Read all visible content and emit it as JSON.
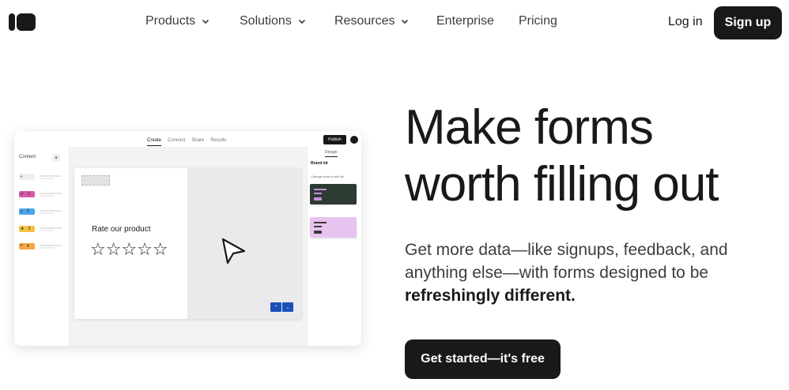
{
  "nav": {
    "menu": [
      {
        "label": "Products",
        "has_dropdown": true
      },
      {
        "label": "Solutions",
        "has_dropdown": true
      },
      {
        "label": "Resources",
        "has_dropdown": true
      },
      {
        "label": "Enterprise",
        "has_dropdown": false
      },
      {
        "label": "Pricing",
        "has_dropdown": false
      }
    ],
    "login_label": "Log in",
    "signup_label": "Sign up"
  },
  "mockup": {
    "tabs": [
      "Create",
      "Connect",
      "Share",
      "Results"
    ],
    "active_tab": "Create",
    "publish_label": "Publish",
    "sidebar_title": "Content",
    "sidebar_add": "+",
    "sidebar_items": [
      {
        "icon": "toggle-icon",
        "color": "#eeeeee",
        "num": ""
      },
      {
        "icon": "check-icon",
        "color": "#d65aa5",
        "num": "1"
      },
      {
        "icon": "list-icon",
        "color": "#4aa7e8",
        "num": "2"
      },
      {
        "icon": "star-icon",
        "color": "#f5c342",
        "num": "3"
      },
      {
        "icon": "quote-icon",
        "color": "#f5a742",
        "num": "4"
      }
    ],
    "question": "Rate our product",
    "stars": "☆☆☆☆☆",
    "nav_up": "⌃",
    "nav_down": "⌄",
    "design_tab": "Design",
    "brand_kit": "Brand kit",
    "theme_hint": "Change looks in and kit",
    "themes": [
      {
        "bg": "#2d3b33",
        "accent": "#c58ee0"
      },
      {
        "bg": "#e7c4ef",
        "accent": "#3a3a3a"
      }
    ]
  },
  "hero": {
    "headline_line1": "Make forms",
    "headline_line2": "worth filling out",
    "subtitle_pre": "Get more data—like signups, feedback, and anything else—with forms designed to be ",
    "subtitle_bold": "refreshingly different.",
    "cta_label": "Get started—it's free"
  }
}
